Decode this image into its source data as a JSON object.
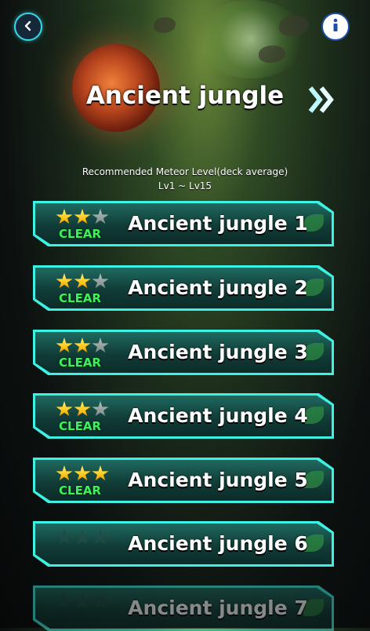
{
  "header": {
    "title": "Ancient jungle"
  },
  "recommendation": {
    "label": "Recommended Meteor Level(deck average)",
    "range": "Lv1 ~ Lv15"
  },
  "icons": {
    "back": "chevron-left-icon",
    "info": "info-icon",
    "next": "double-chevron-right-icon"
  },
  "colors": {
    "border_accent": "#3df2e2",
    "clear_text": "#3cf25a",
    "star_gold": "#ffc316"
  },
  "stages": [
    {
      "name": "Ancient jungle 1",
      "stars": 2,
      "max_stars": 3,
      "status": "CLEAR"
    },
    {
      "name": "Ancient jungle 2",
      "stars": 2,
      "max_stars": 3,
      "status": "CLEAR"
    },
    {
      "name": "Ancient jungle 3",
      "stars": 2,
      "max_stars": 3,
      "status": "CLEAR"
    },
    {
      "name": "Ancient jungle 4",
      "stars": 2,
      "max_stars": 3,
      "status": "CLEAR"
    },
    {
      "name": "Ancient jungle 5",
      "stars": 3,
      "max_stars": 3,
      "status": "CLEAR"
    },
    {
      "name": "Ancient jungle 6",
      "stars": 0,
      "max_stars": 3,
      "status": ""
    },
    {
      "name": "Ancient jungle 7",
      "stars": 0,
      "max_stars": 3,
      "status": ""
    }
  ]
}
